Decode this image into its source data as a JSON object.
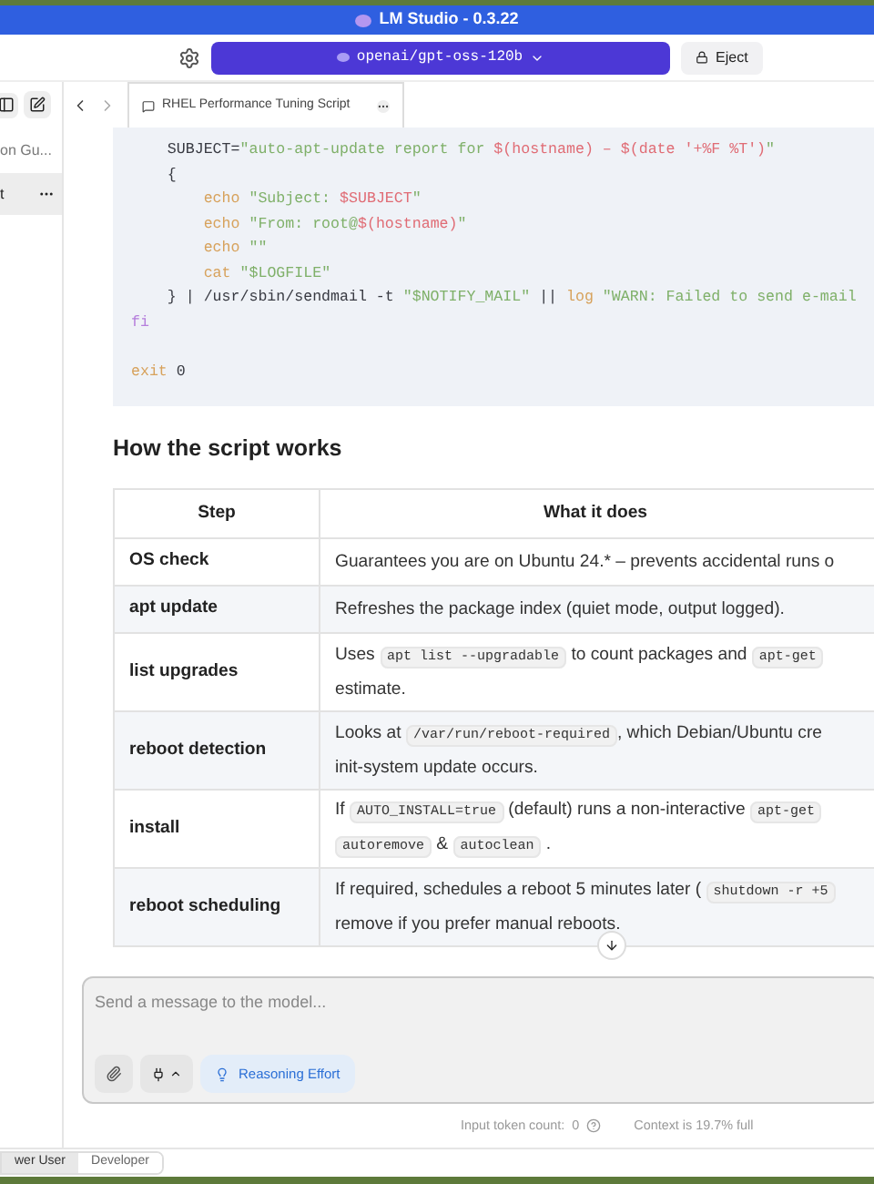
{
  "window": {
    "title": "LM Studio - 0.3.22"
  },
  "toolbar": {
    "model": "openai/gpt-oss-120b",
    "eject": "Eject"
  },
  "sidebar": {
    "items": [
      {
        "label": "on Gu...",
        "selected": false
      },
      {
        "label": "t",
        "selected": true
      }
    ]
  },
  "tab": {
    "title": "RHEL Performance Tuning Script"
  },
  "code": {
    "lines": [
      {
        "segments": [
          {
            "kind": "plain",
            "text": "    SUBJECT="
          },
          {
            "kind": "str",
            "text": "\"auto-apt-update report for "
          },
          {
            "kind": "var",
            "text": "$(hostname) – $(date '+%F %T')"
          },
          {
            "kind": "str",
            "text": "\""
          }
        ]
      },
      {
        "segments": [
          {
            "kind": "plain",
            "text": "    {"
          }
        ]
      },
      {
        "segments": [
          {
            "kind": "cmd",
            "text": "        echo"
          },
          {
            "kind": "str",
            "text": " \"Subject: "
          },
          {
            "kind": "var",
            "text": "$SUBJECT"
          },
          {
            "kind": "str",
            "text": "\""
          }
        ]
      },
      {
        "segments": [
          {
            "kind": "cmd",
            "text": "        echo"
          },
          {
            "kind": "str",
            "text": " \"From: root@"
          },
          {
            "kind": "var",
            "text": "$(hostname)"
          },
          {
            "kind": "str",
            "text": "\""
          }
        ]
      },
      {
        "segments": [
          {
            "kind": "cmd",
            "text": "        echo"
          },
          {
            "kind": "str",
            "text": " \"\""
          }
        ]
      },
      {
        "segments": [
          {
            "kind": "cmd",
            "text": "        cat"
          },
          {
            "kind": "str",
            "text": " \"$LOGFILE\""
          }
        ]
      },
      {
        "segments": [
          {
            "kind": "plain",
            "text": "    } | /usr/sbin/sendmail -t "
          },
          {
            "kind": "str",
            "text": "\"$NOTIFY_MAIL\""
          },
          {
            "kind": "plain",
            "text": " || "
          },
          {
            "kind": "cmd",
            "text": "log"
          },
          {
            "kind": "str",
            "text": " \"WARN: Failed to send e-mail"
          }
        ]
      },
      {
        "segments": [
          {
            "kind": "kw",
            "text": "fi"
          }
        ]
      },
      {
        "blank_before": true,
        "segments": [
          {
            "kind": "cmd",
            "text": "exit"
          },
          {
            "kind": "plain",
            "text": " 0"
          }
        ]
      }
    ]
  },
  "heading": "How the script works",
  "table": {
    "columns": [
      "Step",
      "What it does"
    ],
    "rows": [
      {
        "step": "OS check",
        "lines": [
          [
            {
              "kind": "text",
              "text": "Guarantees you are on Ubuntu 24.* – prevents accidental runs o"
            }
          ]
        ]
      },
      {
        "step": "apt update",
        "lines": [
          [
            {
              "kind": "text",
              "text": "Refreshes the package index (quiet mode, output logged)."
            }
          ]
        ]
      },
      {
        "step": "list upgrades",
        "lines": [
          [
            {
              "kind": "text",
              "text": "Uses "
            },
            {
              "kind": "code",
              "text": "apt list --upgradable"
            },
            {
              "kind": "text",
              "text": " to count packages and "
            },
            {
              "kind": "code",
              "text": "apt-get"
            }
          ],
          [
            {
              "kind": "text",
              "text": "estimate."
            }
          ]
        ]
      },
      {
        "step": "reboot detection",
        "lines": [
          [
            {
              "kind": "text",
              "text": "Looks at "
            },
            {
              "kind": "code",
              "text": "/var/run/reboot-required"
            },
            {
              "kind": "text",
              "text": ", which Debian/Ubuntu cre"
            }
          ],
          [
            {
              "kind": "text",
              "text": "init-system update occurs."
            }
          ]
        ]
      },
      {
        "step": "install",
        "lines": [
          [
            {
              "kind": "text",
              "text": "If "
            },
            {
              "kind": "code",
              "text": "AUTO_INSTALL=true"
            },
            {
              "kind": "text",
              "text": " (default) runs a non-interactive "
            },
            {
              "kind": "code",
              "text": "apt-get"
            }
          ],
          [
            {
              "kind": "code",
              "text": "autoremove"
            },
            {
              "kind": "text",
              "text": " & "
            },
            {
              "kind": "code",
              "text": "autoclean"
            },
            {
              "kind": "text",
              "text": " ."
            }
          ]
        ]
      },
      {
        "step": "reboot scheduling",
        "lines": [
          [
            {
              "kind": "text",
              "text": "If required, schedules a reboot 5 minutes later ( "
            },
            {
              "kind": "code",
              "text": "shutdown -r +5"
            }
          ],
          [
            {
              "kind": "text",
              "text": "remove if you prefer manual reboots."
            }
          ]
        ]
      }
    ]
  },
  "composer": {
    "placeholder": "Send a message to the model...",
    "reasoning": "Reasoning Effort"
  },
  "footer": {
    "token_label": "Input token count:",
    "token_value": "0",
    "context": "Context is 19.7% full"
  },
  "mode_tabs": [
    {
      "label": "wer User",
      "selected": true
    },
    {
      "label": "Developer",
      "selected": false
    }
  ]
}
